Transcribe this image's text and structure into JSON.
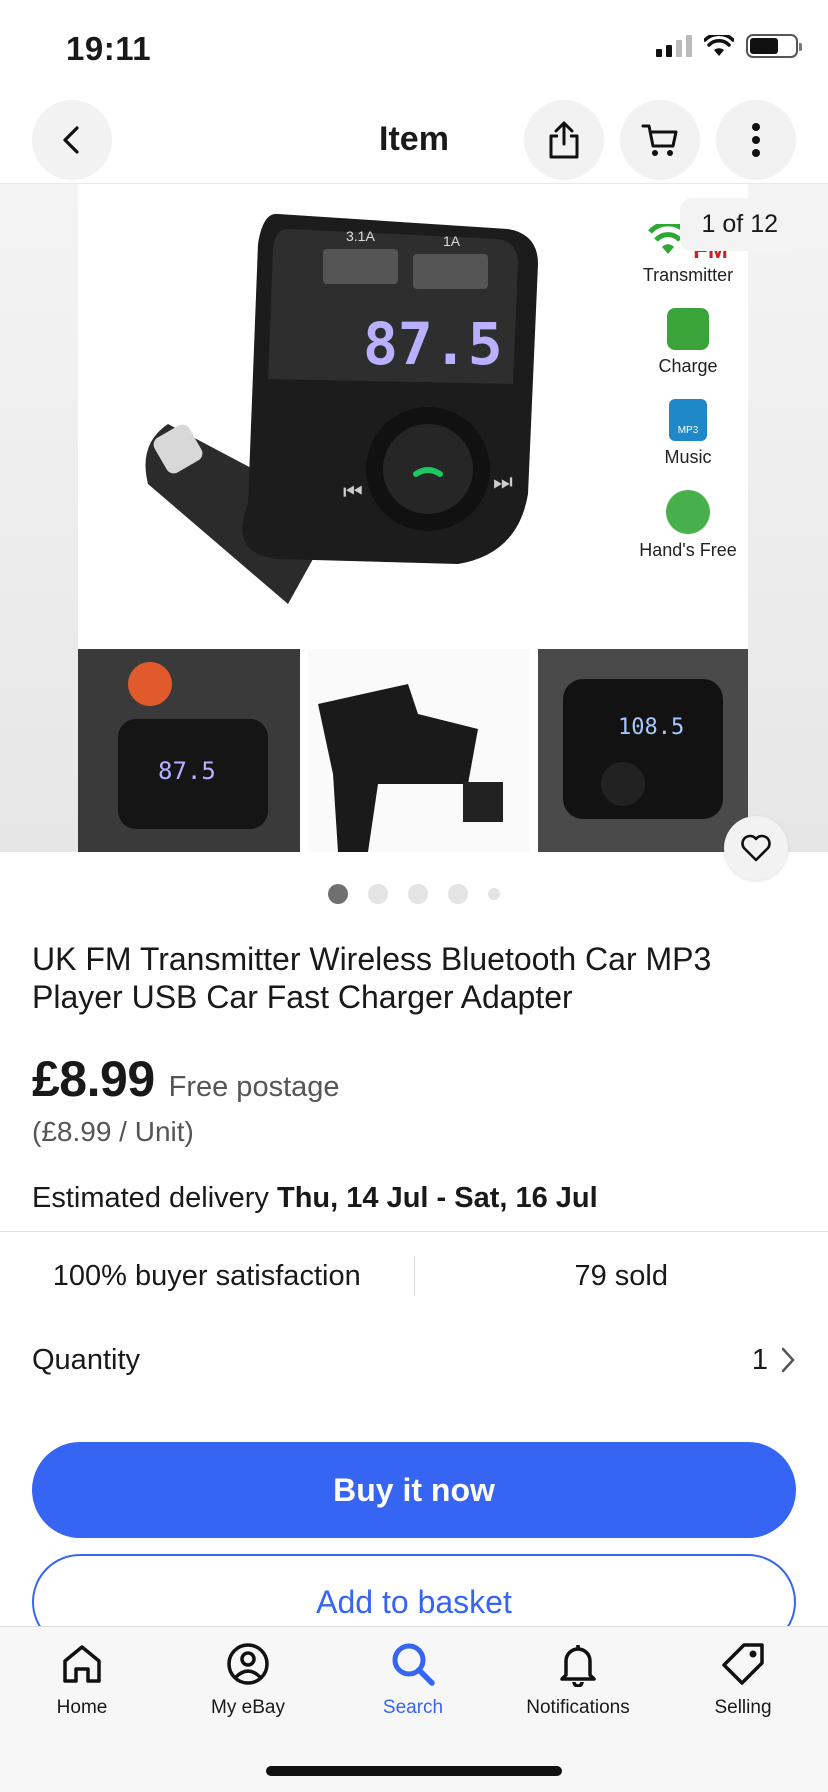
{
  "status_bar": {
    "time": "19:11"
  },
  "nav": {
    "title": "Item"
  },
  "gallery": {
    "counter": "1 of 12",
    "product_image": {
      "port_labels": [
        "3.1A",
        "1A"
      ],
      "display": "87.5",
      "features": [
        "FM",
        "Transmitter",
        "Charge",
        "Music",
        "MP3",
        "Hand's Free"
      ],
      "thumb_displays": [
        "87.5",
        "108.5"
      ]
    },
    "dots_total": 5,
    "dots_active": 1
  },
  "product": {
    "title": "UK FM Transmitter Wireless Bluetooth Car MP3 Player USB Car Fast Charger Adapter",
    "price": "£8.99",
    "postage": "Free postage",
    "unit_price": "(£8.99 / Unit)",
    "delivery_label": "Estimated delivery",
    "delivery_dates": "Thu, 14 Jul - Sat, 16 Jul"
  },
  "stats": {
    "satisfaction": "100% buyer satisfaction",
    "sold": "79 sold"
  },
  "quantity": {
    "label": "Quantity",
    "value": "1"
  },
  "actions": {
    "buy_now": "Buy it now",
    "add_basket": "Add to basket"
  },
  "tabbar": {
    "items": [
      {
        "label": "Home",
        "icon": "home-icon"
      },
      {
        "label": "My eBay",
        "icon": "user-icon"
      },
      {
        "label": "Search",
        "icon": "search-icon"
      },
      {
        "label": "Notifications",
        "icon": "bell-icon"
      },
      {
        "label": "Selling",
        "icon": "tag-icon"
      }
    ],
    "active": "Search"
  },
  "colors": {
    "accent": "#3665f3",
    "text": "#191919",
    "secondary": "#555555"
  }
}
